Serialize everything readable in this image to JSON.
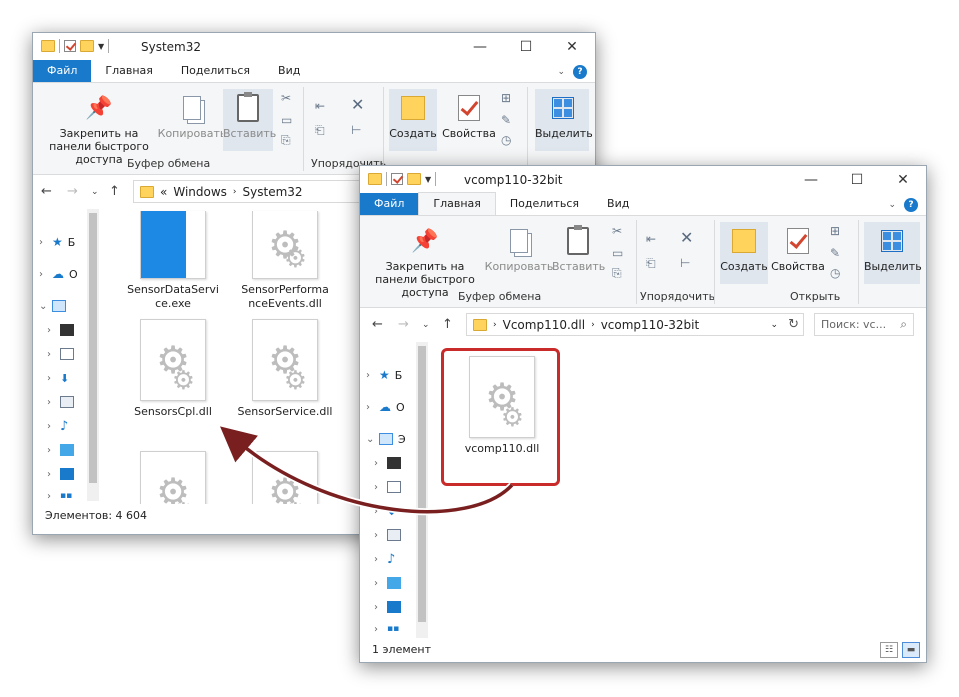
{
  "window_back": {
    "title": "System32",
    "menu": {
      "file": "Файл",
      "home": "Главная",
      "share": "Поделиться",
      "view": "Вид"
    },
    "ribbon": {
      "pin": "Закрепить на панели быстрого доступа",
      "copy": "Копировать",
      "paste": "Вставить",
      "group_clipboard": "Буфер обмена",
      "group_organize": "Упорядочить",
      "new": "Создать",
      "properties": "Свойства",
      "select": "Выделить"
    },
    "address": {
      "sep": "«",
      "parts": [
        "Windows",
        "System32"
      ]
    },
    "nav_labels": [
      "Б",
      "О"
    ],
    "files": [
      "SensorDataService.exe",
      "SensorPerformanceEvents.dll",
      "SensorsCpl.dll",
      "SensorService.dll"
    ],
    "status": "Элементов: 4 604"
  },
  "window_front": {
    "title": "vcomp110-32bit",
    "menu": {
      "file": "Файл",
      "home": "Главная",
      "share": "Поделиться",
      "view": "Вид"
    },
    "ribbon": {
      "pin": "Закрепить на панели быстрого доступа",
      "copy": "Копировать",
      "paste": "Вставить",
      "group_clipboard": "Буфер обмена",
      "group_organize": "Упорядочить",
      "new": "Создать",
      "properties": "Свойства",
      "group_open": "Открыть",
      "select": "Выделить"
    },
    "address": {
      "parts": [
        "Vcomp110.dll",
        "vcomp110-32bit"
      ]
    },
    "search_placeholder": "Поиск: vc...",
    "nav_labels": [
      "Б",
      "О",
      "Э"
    ],
    "files": [
      "vcomp110.dll"
    ],
    "status": "1 элемент"
  },
  "colors": {
    "accent": "#1979ca",
    "highlight_frame": "#c92a2a",
    "arrow": "#7a1f1f",
    "folder": "#ffd35c"
  }
}
